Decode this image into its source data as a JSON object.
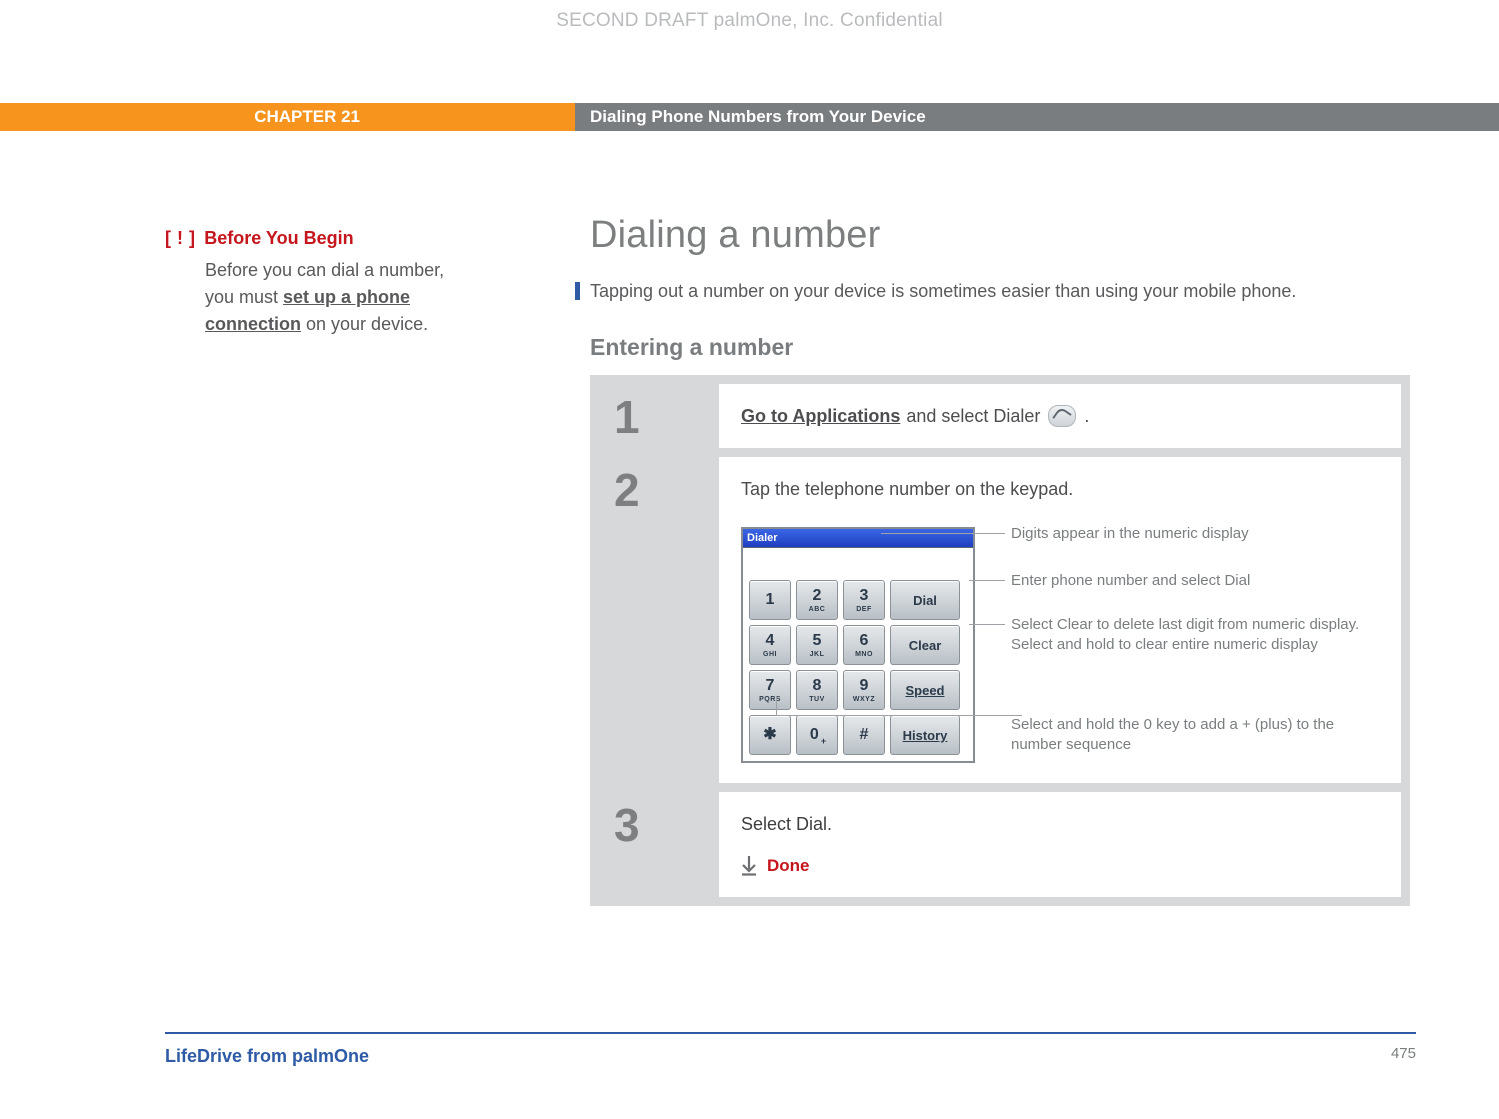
{
  "confidential": "SECOND DRAFT palmOne, Inc.  Confidential",
  "chapter": {
    "label": "CHAPTER 21",
    "title": "Dialing Phone Numbers from Your Device"
  },
  "sidebar": {
    "marker": "[ ! ]",
    "heading": "Before You Begin",
    "body_pre": "Before you can dial a number, you must ",
    "body_link": "set up a phone connection",
    "body_post": " on your device."
  },
  "main": {
    "h1": "Dialing a number",
    "lede": "Tapping out a number on your device is sometimes easier than using your mobile phone.",
    "h2": "Entering a number"
  },
  "steps": {
    "s1": {
      "num": "1",
      "link": "Go to Applications",
      "text_post": " and select Dialer ",
      "period": "."
    },
    "s2": {
      "num": "2",
      "text": "Tap the telephone number on the keypad.",
      "callouts": {
        "display": "Digits appear in the numeric display",
        "dial": "Enter phone number and select Dial",
        "clear": "Select Clear to delete last digit from numeric display. Select and hold to clear entire numeric display",
        "zero": "Select and hold the 0 key to add a + (plus) to the number sequence"
      },
      "keypad": {
        "title": "Dialer",
        "keys": {
          "k1": "1",
          "k2": "2",
          "k2s": "ABC",
          "k3": "3",
          "k3s": "DEF",
          "k4": "4",
          "k4s": "GHI",
          "k5": "5",
          "k5s": "JKL",
          "k6": "6",
          "k6s": "MNO",
          "k7": "7",
          "k7s": "PQRS",
          "k8": "8",
          "k8s": "TUV",
          "k9": "9",
          "k9s": "WXYZ",
          "kstar": "✱",
          "k0": "0",
          "k0s": "+",
          "khash": "#",
          "dial": "Dial",
          "clear": "Clear",
          "speed": "Speed",
          "history": "History"
        }
      }
    },
    "s3": {
      "num": "3",
      "text": "Select Dial.",
      "done": "Done"
    }
  },
  "footer": {
    "product": "LifeDrive from palmOne",
    "page": "475"
  }
}
